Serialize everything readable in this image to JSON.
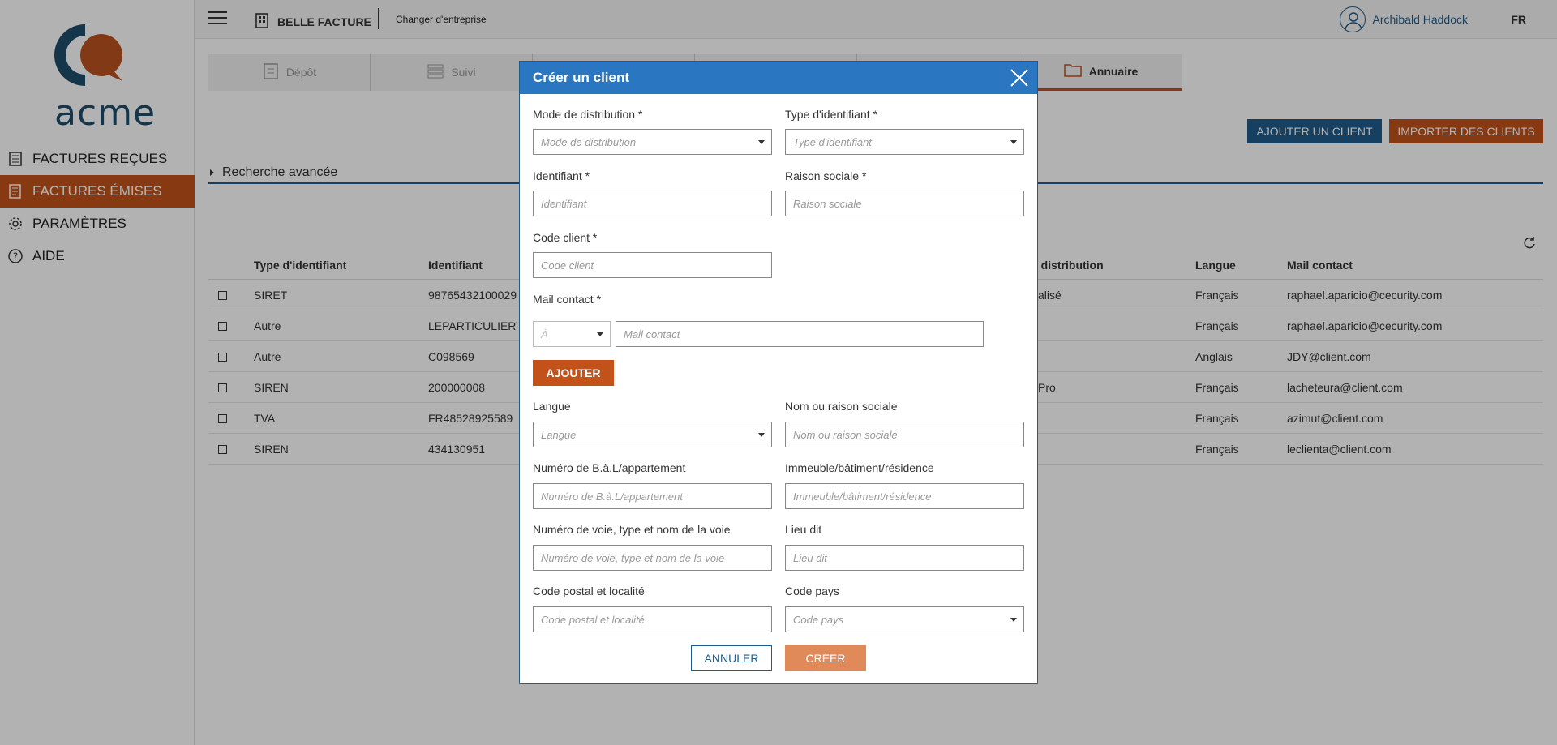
{
  "brand": {
    "logo_text": "acme",
    "company": "BELLE FACTURE",
    "change_company": "Changer d'entreprise",
    "user": "Archibald Haddock",
    "lang": "FR"
  },
  "sidebar": {
    "items": [
      {
        "label": "FACTURES REÇUES",
        "icon": "building-icon",
        "active": false
      },
      {
        "label": "FACTURES ÉMISES",
        "icon": "invoice-icon",
        "active": true
      },
      {
        "label": "PARAMÈTRES",
        "icon": "gear-icon",
        "active": false
      },
      {
        "label": "AIDE",
        "icon": "help-icon",
        "active": false
      }
    ]
  },
  "tabs": [
    {
      "label": "Dépôt",
      "icon": "deposit-icon"
    },
    {
      "label": "Suivi",
      "icon": "list-icon"
    },
    {
      "label": "",
      "icon": ""
    },
    {
      "label": "",
      "icon": ""
    },
    {
      "label": "",
      "icon": ""
    },
    {
      "label": "Annuaire",
      "icon": "folder-icon"
    }
  ],
  "actions": {
    "add_client": "AJOUTER UN CLIENT",
    "import_clients": "IMPORTER DES CLIENTS"
  },
  "search": {
    "advanced": "Recherche avancée"
  },
  "table": {
    "headers": {
      "type": "Type d'identifiant",
      "id": "Identifiant",
      "distribution": "e distribution",
      "langue": "Langue",
      "mail": "Mail contact"
    },
    "rows": [
      {
        "type": "SIRET",
        "id": "98765432100029",
        "distribution": "alisé",
        "langue": "Français",
        "mail": "raphael.aparicio@cecurity.com"
      },
      {
        "type": "Autre",
        "id": "LEPARTICULIERTF",
        "distribution": "",
        "langue": "Français",
        "mail": "raphael.aparicio@cecurity.com"
      },
      {
        "type": "Autre",
        "id": "C098569",
        "distribution": "",
        "langue": "Anglais",
        "mail": "JDY@client.com"
      },
      {
        "type": "SIREN",
        "id": "200000008",
        "distribution": "Pro",
        "langue": "Français",
        "mail": "lacheteura@client.com"
      },
      {
        "type": "TVA",
        "id": "FR48528925589",
        "distribution": "",
        "langue": "Français",
        "mail": "azimut@client.com"
      },
      {
        "type": "SIREN",
        "id": "434130951",
        "distribution": "",
        "langue": "Français",
        "mail": "leclienta@client.com"
      }
    ]
  },
  "modal": {
    "title": "Créer un client",
    "fields": {
      "mode_label": "Mode de distribution *",
      "mode_ph": "Mode de distribution",
      "type_label": "Type d'identifiant *",
      "type_ph": "Type d'identifiant",
      "ident_label": "Identifiant *",
      "ident_ph": "Identifiant",
      "raison_label": "Raison sociale *",
      "raison_ph": "Raison sociale",
      "code_label": "Code client *",
      "code_ph": "Code client",
      "mail_label": "Mail contact *",
      "mail_prefix": "À",
      "mail_ph": "Mail contact",
      "langue_label": "Langue",
      "langue_ph": "Langue",
      "nom_label": "Nom ou raison sociale",
      "nom_ph": "Nom ou raison sociale",
      "bal_label": "Numéro de B.à.L/appartement",
      "bal_ph": "Numéro de B.à.L/appartement",
      "imm_label": "Immeuble/bâtiment/résidence",
      "imm_ph": "Immeuble/bâtiment/résidence",
      "voie_label": "Numéro de voie, type et nom de la voie",
      "voie_ph": "Numéro de voie, type et nom de la voie",
      "lieu_label": "Lieu dit",
      "lieu_ph": "Lieu dit",
      "cp_label": "Code postal et localité",
      "cp_ph": "Code postal et localité",
      "pays_label": "Code pays",
      "pays_ph": "Code pays"
    },
    "ajouter": "AJOUTER",
    "annuler": "ANNULER",
    "creer": "CRÉER"
  }
}
